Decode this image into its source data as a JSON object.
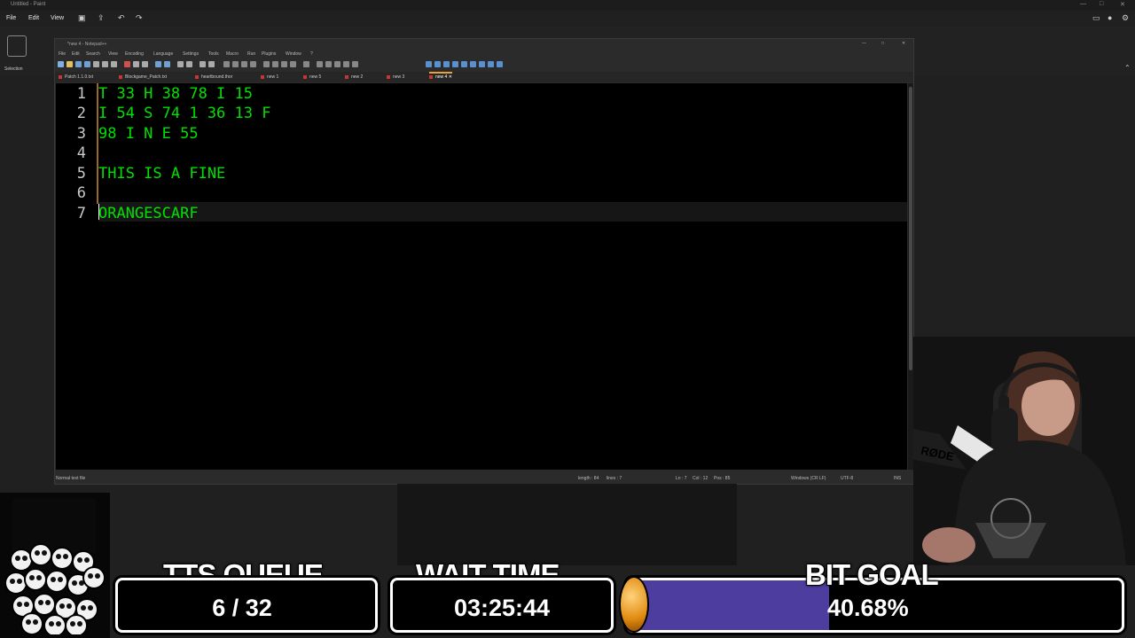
{
  "paint": {
    "title": "Untitled - Paint",
    "menu": [
      "File",
      "Edit",
      "View"
    ],
    "selection_label": "Selection"
  },
  "notepad": {
    "title": "*new 4 - Notepad++",
    "menu": [
      "File",
      "Edit",
      "Search",
      "View",
      "Encoding",
      "Language",
      "Settings",
      "Tools",
      "Macro",
      "Run",
      "Plugins",
      "Window",
      "?"
    ],
    "tabs": [
      {
        "label": "Patch 1.1.0.txt",
        "active": false
      },
      {
        "label": "Blockgame_Patch.txt",
        "active": false
      },
      {
        "label": "heartbound.thor",
        "active": false
      },
      {
        "label": "new 1",
        "active": false
      },
      {
        "label": "new 5",
        "active": false
      },
      {
        "label": "new 2",
        "active": false
      },
      {
        "label": "new 3",
        "active": false
      },
      {
        "label": "new 4",
        "active": true
      }
    ],
    "lines": [
      {
        "num": "1",
        "text": "T 33 H 38 78 I 15"
      },
      {
        "num": "2",
        "text": "I 54 S 74 1 36 13 F"
      },
      {
        "num": "3",
        "text": "98 I N E 55"
      },
      {
        "num": "4",
        "text": ""
      },
      {
        "num": "5",
        "text": "THIS IS A FINE"
      },
      {
        "num": "6",
        "text": ""
      },
      {
        "num": "7",
        "text": "ORANGESCARF"
      }
    ],
    "status": {
      "file_type": "Normal text file",
      "length": "length : 84",
      "lines": "lines : 7",
      "ln": "Ln : 7",
      "col": "Col : 12",
      "pos": "Pos : 85",
      "eol": "Windows (CR LF)",
      "encoding": "UTF-8",
      "mode": "INS"
    }
  },
  "overlay": {
    "tts_title": "TTS QUEUE",
    "tts_value": "6 / 32",
    "wait_title": "WAIT TIME",
    "wait_value": "03:25:44",
    "bit_title": "BIT GOAL",
    "bit_value": "40.68%",
    "bit_progress": 0.4068,
    "mic_brand": "RØDE"
  },
  "colors": {
    "code_text": "#00e000",
    "bit_fill": "#4c3d9e",
    "fold_marker": "#e8a33c"
  }
}
